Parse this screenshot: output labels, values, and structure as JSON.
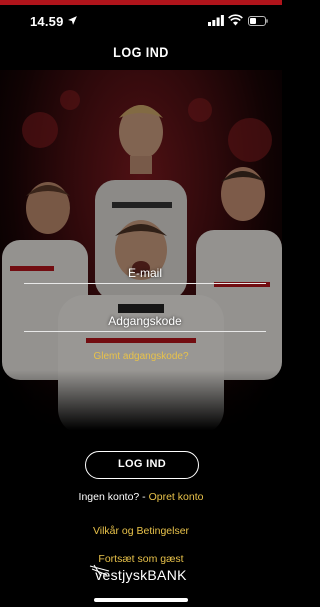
{
  "status_bar": {
    "time": "14.59",
    "icons": [
      "location-arrow-icon",
      "signal-icon",
      "wifi-icon",
      "battery-icon"
    ]
  },
  "header": {
    "title": "LOG IND"
  },
  "form": {
    "email_label": "E-mail",
    "password_label": "Adgangskode",
    "forgot_password": "Glemt adgangskode?"
  },
  "actions": {
    "login_button": "LOG IND",
    "no_account_text": "Ingen konto? -",
    "create_account_link": "Opret konto",
    "terms_link": "Vilkår og Betingelser",
    "guest_link": "Fortsæt som gæst"
  },
  "brand": {
    "name": "vestjyskBANK"
  },
  "colors": {
    "accent_gold": "#e8c24a",
    "brand_red": "#b0141b",
    "background": "#000000"
  }
}
